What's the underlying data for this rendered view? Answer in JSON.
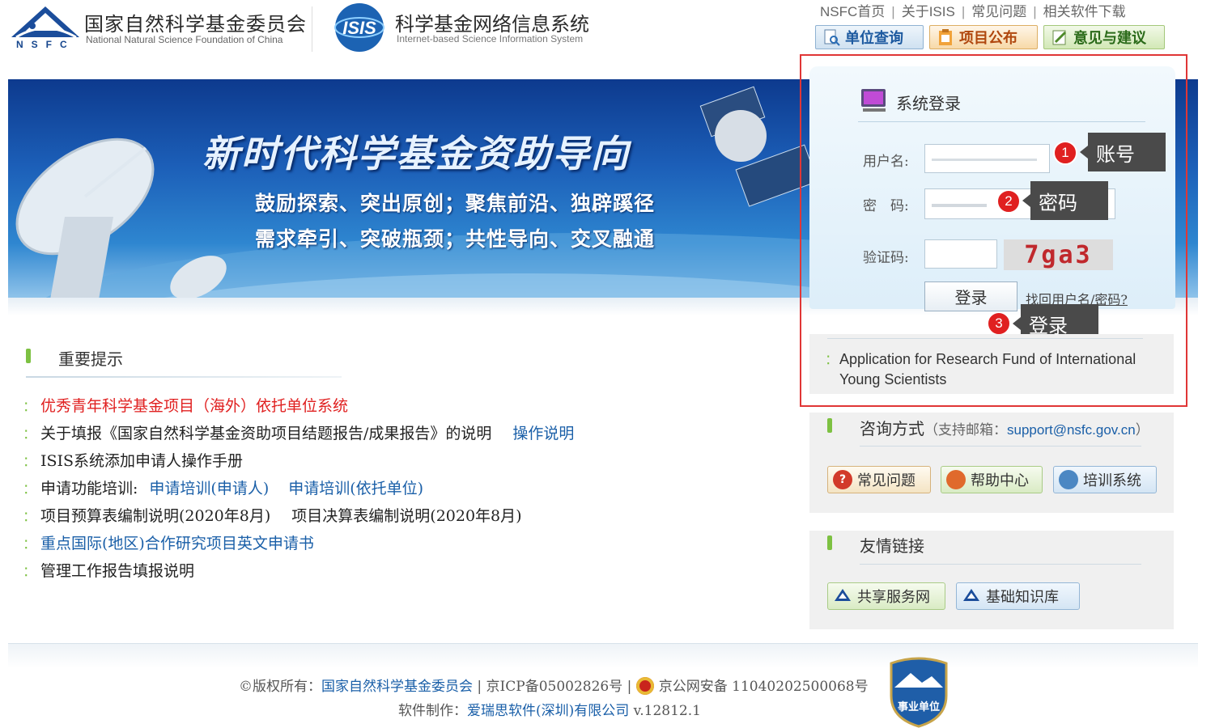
{
  "header": {
    "nsfc_name_cn": "国家自然科学基金委员会",
    "nsfc_name_en": "National Natural Science Foundation of China",
    "nsfc_letters": "NSFC",
    "isis_logo_text": "ISIS",
    "isis_name_cn": "科学基金网络信息系统",
    "isis_name_en": "Internet-based Science Information System"
  },
  "topnav": {
    "links": [
      "NSFC首页",
      "关于ISIS",
      "常见问题",
      "相关软件下载"
    ],
    "buttons": [
      "单位查询",
      "项目公布",
      "意见与建议"
    ]
  },
  "banner": {
    "title": "新时代科学基金资助导向",
    "line1": "鼓励探索、突出原创；聚焦前沿、独辟蹊径",
    "line2": "需求牵引、突破瓶颈；共性导向、交叉融通"
  },
  "login": {
    "title": "系统登录",
    "username_label": "用户名:",
    "password_label": "密　码:",
    "captcha_label": "验证码:",
    "captcha_text": "7ga3",
    "login_button": "登录",
    "forgot_link": "找回用户名/密码?",
    "intl_link": "Application for Research Fund of International Young Scientists"
  },
  "callouts": {
    "c1_num": "1",
    "c1_text": "账号",
    "c2_num": "2",
    "c2_text": "密码",
    "c3_num": "3",
    "c3_text": "登录"
  },
  "notices": {
    "title": "重要提示",
    "row1": "优秀青年科学基金项目（海外）依托单位系统",
    "row2_text": "关于填报《国家自然科学基金资助项目结题报告/成果报告》的说明",
    "row2_link": "操作说明",
    "row3": "ISIS系统添加申请人操作手册",
    "row4_prefix": "申请功能培训:",
    "row4_link1": "申请培训(申请人)",
    "row4_link2": "申请培训(依托单位)",
    "row5_a": "项目预算表编制说明(2020年8月)",
    "row5_b": "项目决算表编制说明(2020年8月)",
    "row6": "重点国际(地区)合作研究项目英文申请书",
    "row7": "管理工作报告填报说明"
  },
  "consult": {
    "title": "咨询方式",
    "note_prefix": "（支持邮箱：",
    "email": "support@nsfc.gov.cn",
    "note_suffix": "）",
    "buttons": [
      "常见问题",
      "帮助中心",
      "培训系统"
    ]
  },
  "links": {
    "title": "友情链接",
    "buttons": [
      "共享服务网",
      "基础知识库"
    ]
  },
  "footer": {
    "copyright_prefix": "©版权所有：",
    "copyright_org": "国家自然科学基金委员会",
    "icp": " | 京ICP备05002826号 | ",
    "police": "京公网安备 11040202500068号",
    "maker_prefix": "软件制作：",
    "maker": "爱瑞思软件(深圳)有限公司",
    "version": " v.12812.1",
    "shield_text": "事业单位"
  },
  "colors": {
    "accent_blue": "#1a5fa8",
    "alert_red": "#e02020",
    "section_green": "#7dc142",
    "frame_red": "#e03636"
  }
}
